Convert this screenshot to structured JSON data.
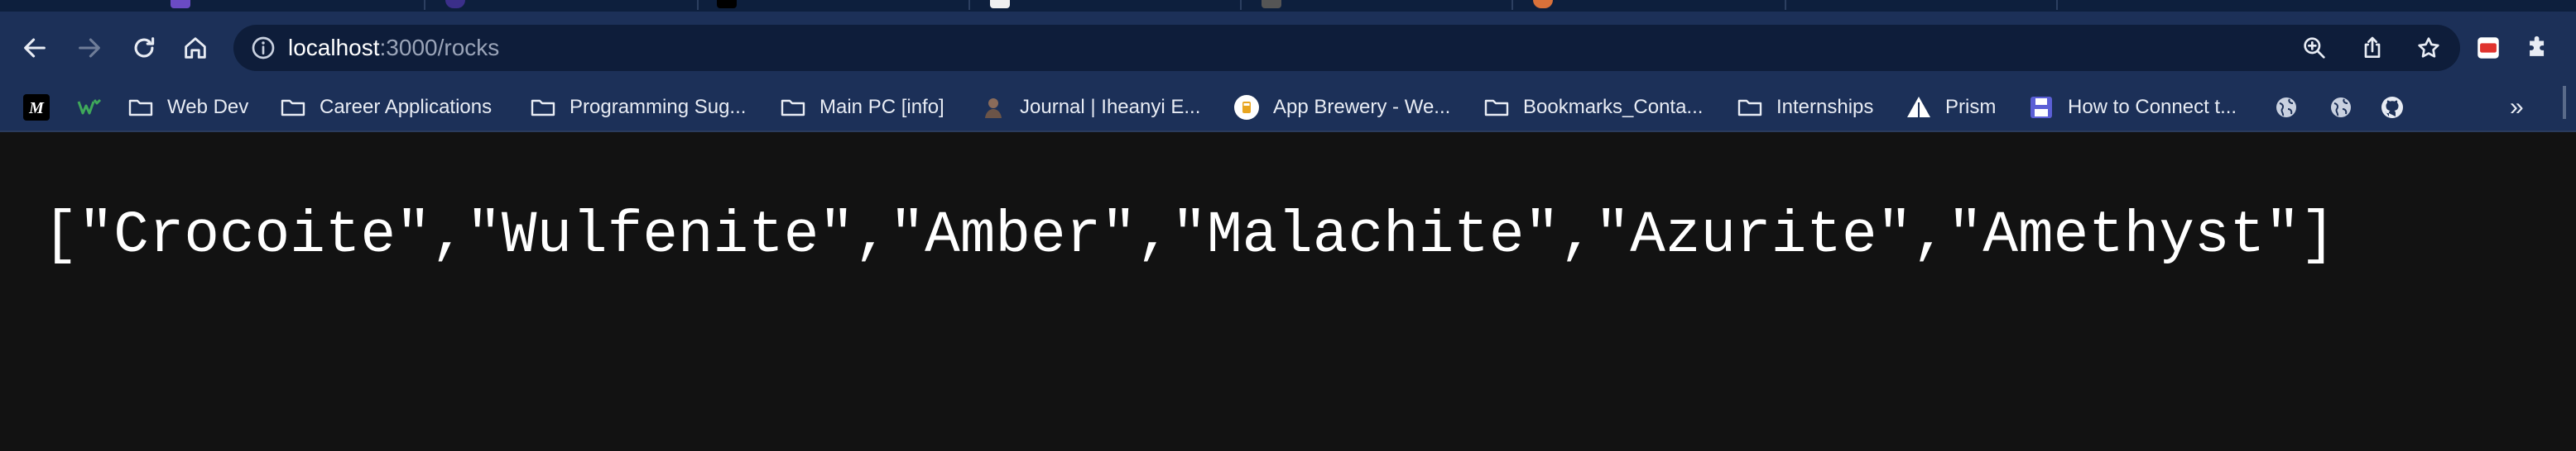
{
  "toolbar": {
    "url_host": "localhost",
    "url_path": ":3000/rocks"
  },
  "bookmarks": [
    {
      "label": "",
      "icon": "medium-icon"
    },
    {
      "label": "",
      "icon": "webflow-icon"
    },
    {
      "label": "Web Dev",
      "icon": "folder-icon"
    },
    {
      "label": "Career Applications",
      "icon": "folder-icon"
    },
    {
      "label": "Programming Sug...",
      "icon": "folder-icon"
    },
    {
      "label": "Main PC [info]",
      "icon": "folder-icon"
    },
    {
      "label": "Journal | Iheanyi E...",
      "icon": "journal-icon"
    },
    {
      "label": "App Brewery - We...",
      "icon": "app-brewery-icon"
    },
    {
      "label": "Bookmarks_Conta...",
      "icon": "folder-icon"
    },
    {
      "label": "Internships",
      "icon": "folder-icon"
    },
    {
      "label": "Prism",
      "icon": "prism-icon"
    },
    {
      "label": "How to Connect t...",
      "icon": "floppy-icon"
    }
  ],
  "bookmarks_more": "»",
  "response_body": "[\"Crocoite\",\"Wulfenite\",\"Amber\",\"Malachite\",\"Azurite\",\"Amethyst\"]",
  "colors": {
    "toolbar_bg": "#1c3058",
    "page_bg": "#121212",
    "text": "#ffffff"
  }
}
